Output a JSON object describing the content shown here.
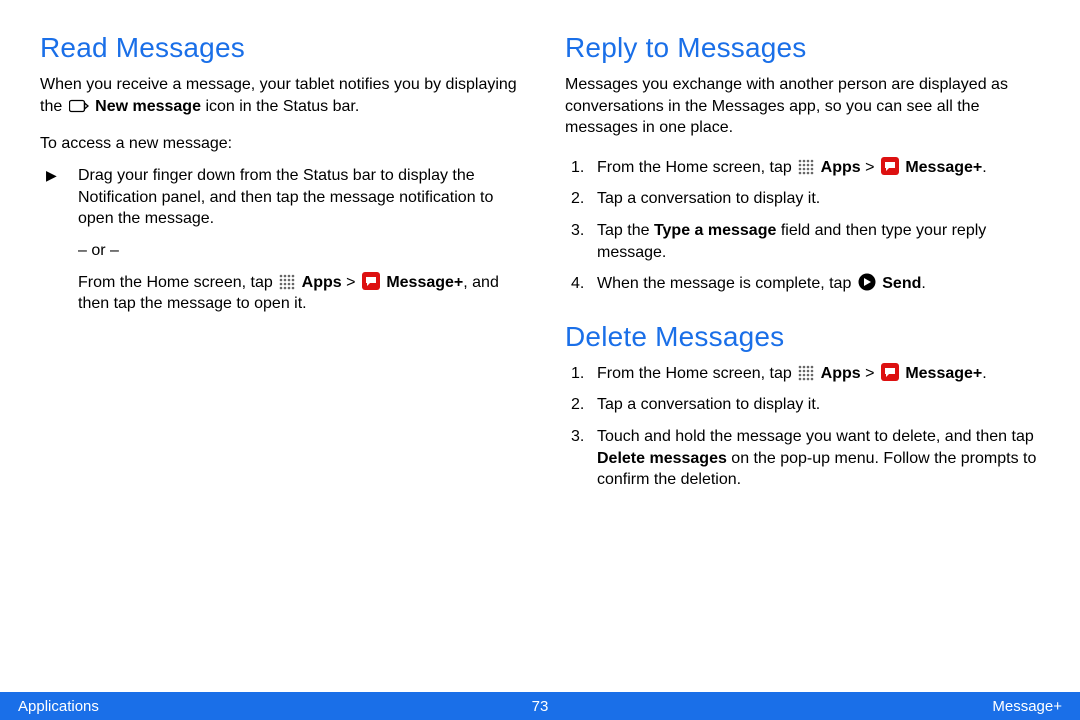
{
  "left": {
    "heading": "Read Messages",
    "intro_before_icon": "When you receive a message, your tablet notifies you by displaying the ",
    "intro_icon_label": "New message",
    "intro_after_icon": " icon in the Status bar.",
    "access_lead": "To access a new message:",
    "bullet1": "Drag your finger down from the Status bar to display the Notification panel, and then tap the message notification to open the message.",
    "or": "– or –",
    "bullet2_a": "From the Home screen, tap ",
    "bullet2_apps": "Apps",
    "bullet2_gt": " > ",
    "bullet2_msg": "Message+",
    "bullet2_tail": ", and then tap the message to open it."
  },
  "right": {
    "reply": {
      "heading": "Reply to Messages",
      "intro": "Messages you exchange with another person are displayed as conversations in the Messages app, so you can see all the messages in one place.",
      "step1_a": "From the Home screen, tap ",
      "step1_apps": "Apps",
      "step1_gt": " > ",
      "step1_msg": "Message+",
      "step1_tail": ".",
      "step2": "Tap a conversation to display it.",
      "step3_a": "Tap the ",
      "step3_bold": "Type a message",
      "step3_b": " field and then type your reply message.",
      "step4_a": "When the message is complete, tap ",
      "step4_send": "Send",
      "step4_tail": "."
    },
    "delete": {
      "heading": "Delete Messages",
      "step1_a": "From the Home screen, tap ",
      "step1_apps": "Apps",
      "step1_gt": " > ",
      "step1_msg": "Message+",
      "step1_tail": ".",
      "step2": "Tap a conversation to display it.",
      "step3_a": "Touch and hold the message you want to delete, and then tap ",
      "step3_bold": "Delete messages",
      "step3_b": " on the pop-up menu. Follow the prompts to confirm the deletion."
    }
  },
  "footer": {
    "left": "Applications",
    "center": "73",
    "right": "Message+"
  }
}
